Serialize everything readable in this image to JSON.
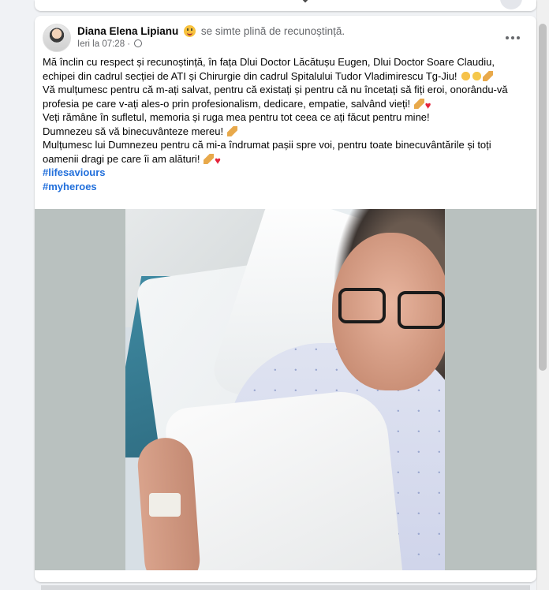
{
  "post": {
    "author": "Diana Elena Lipianu",
    "feeling": "se simte plină de recunoștință.",
    "timestamp": "Ieri la 07:28 ·",
    "paragraphs": [
      "Mă înclin cu respect și recunoștință, în fața Dlui Doctor Lăcătușu Eugen, Dlui Doctor Soare Claudiu, echipei din cadrul secției de ATI și Chirurgie din cadrul Spitalului Tudor Vladimirescu Tg-Jiu!",
      "Vă mulțumesc pentru că m-ați salvat, pentru că existați și pentru că nu încetați să fiți eroi, onorându-vă profesia pe care v-ați ales-o prin profesionalism, dedicare, empatie, salvând vieți!",
      "Veți rămâne în sufletul, memoria și ruga mea pentru tot ceea ce ați făcut pentru mine!",
      "Dumnezeu să vă binecuvânteze mereu!",
      "Mulțumesc lui Dumnezeu pentru că mi-a îndrumat pașii spre voi, pentru toate binecuvântările și toți oamenii dragi pe care îi am alături!"
    ],
    "hashtags": [
      "#lifesaviours",
      "#myheroes"
    ]
  },
  "icons": {
    "avatar": "profile-photo",
    "more": "more-horizontal-icon",
    "privacy": "globe-icon"
  },
  "colors": {
    "link": "#216fdb",
    "secondary_text": "#65676b",
    "heart": "#e4223a"
  }
}
